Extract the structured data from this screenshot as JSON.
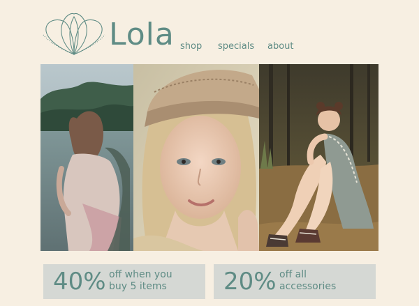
{
  "brand": {
    "name": "Lola",
    "logo_icon": "lotus-petals-icon",
    "color": "#5f8c85"
  },
  "nav": {
    "items": [
      {
        "label": "shop"
      },
      {
        "label": "specials"
      },
      {
        "label": "about"
      }
    ]
  },
  "gallery": {
    "photos": [
      {
        "subject": "girl-by-lake-photo"
      },
      {
        "subject": "girl-with-hat-portrait-photo"
      },
      {
        "subject": "girl-sitting-outdoors-photo"
      }
    ]
  },
  "promos": [
    {
      "percent": "40%",
      "line1": "off when you",
      "line2": "buy 5 items"
    },
    {
      "percent": "20%",
      "line1": "off all",
      "line2": "accessories"
    }
  ],
  "colors": {
    "background": "#f7efe2",
    "accent": "#5f8c85",
    "promo_bg": "#d5d8d4"
  }
}
